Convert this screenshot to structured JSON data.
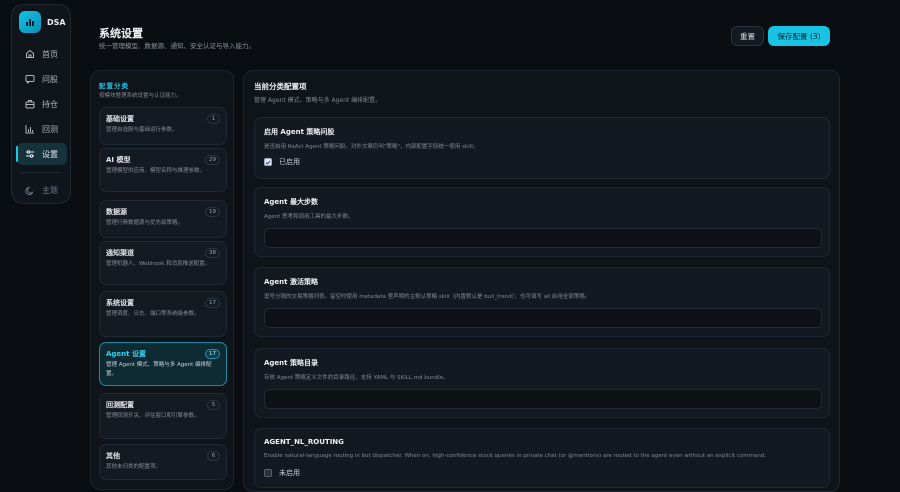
{
  "app": {
    "brand": "DSA"
  },
  "nav": [
    {
      "label": "首页",
      "icon": "home-icon"
    },
    {
      "label": "问股",
      "icon": "chat-icon"
    },
    {
      "label": "持仓",
      "icon": "briefcase-icon"
    },
    {
      "label": "回测",
      "icon": "bar-chart-icon"
    },
    {
      "label": "设置",
      "icon": "sliders-icon",
      "active": true
    }
  ],
  "theme_label": "主题",
  "header": {
    "title": "系统设置",
    "subtitle": "统一管理模型、数据源、通知、安全认证与导入能力。",
    "reset_label": "重置",
    "save_label": "保存配置 (3)"
  },
  "categories": {
    "title": "配置分类",
    "subtitle": "按模块整理系统设置与认证能力。",
    "items": [
      {
        "name": "基础设置",
        "desc": "管理自选股与基础运行参数。",
        "count": "1"
      },
      {
        "name": "AI 模型",
        "desc": "管理模型供应商、模型名称与推理参数。",
        "count": "29"
      },
      {
        "name": "数据源",
        "desc": "管理行情数据源与优先级策略。",
        "count": "19"
      },
      {
        "name": "通知渠道",
        "desc": "管理机器人、Webhook 和消息推送配置。",
        "count": "38"
      },
      {
        "name": "系统设置",
        "desc": "管理调度、日志、端口等系统级参数。",
        "count": "17"
      },
      {
        "name": "Agent 设置",
        "desc": "管理 Agent 模式、策略与多 Agent 编排配置。",
        "count": "17",
        "active": true
      },
      {
        "name": "回测配置",
        "desc": "管理回测开关、评估窗口和引擎参数。",
        "count": "5"
      },
      {
        "name": "其他",
        "desc": "其他未归类的配置项。",
        "count": "6"
      }
    ]
  },
  "main": {
    "title": "当前分类配置项",
    "subtitle": "管理 Agent 模式、策略与多 Agent 编排配置。",
    "cards": [
      {
        "title": "启用 Agent 策略问股",
        "desc": "是否启用 ReAct Agent 策略问股。对外文案仍叫\"策略\"，内部配置字段统一使用 skill。",
        "type": "checkbox",
        "checked": true,
        "check_label": "已启用"
      },
      {
        "title": "Agent 最大步数",
        "desc": "Agent 思考和调用工具的最大步数。",
        "type": "input",
        "value": ""
      },
      {
        "title": "Agent 激活策略",
        "desc": "逗号分隔的交易策略列表。留空时使用 metadata 里声明的主默认策略 skill（内置默认是 bull_trend）；也可填写 all 启用全部策略。",
        "type": "input",
        "value": ""
      },
      {
        "title": "Agent 策略目录",
        "desc": "存放 Agent 策略定义文件的目录路径，支持 YAML 与 SKILL.md bundle。",
        "type": "input",
        "value": ""
      },
      {
        "title": "AGENT_NL_ROUTING",
        "desc": "Enable natural-language routing in bot dispatcher. When on, high-confidence stock queries in private chat (or @mentions) are routed to the agent even without an explicit command.",
        "type": "checkbox",
        "checked": false,
        "check_label": "未启用"
      }
    ]
  },
  "colors": {
    "accent": "#17c2e3",
    "background": "#0a0d12",
    "panel": "#0f141a"
  }
}
